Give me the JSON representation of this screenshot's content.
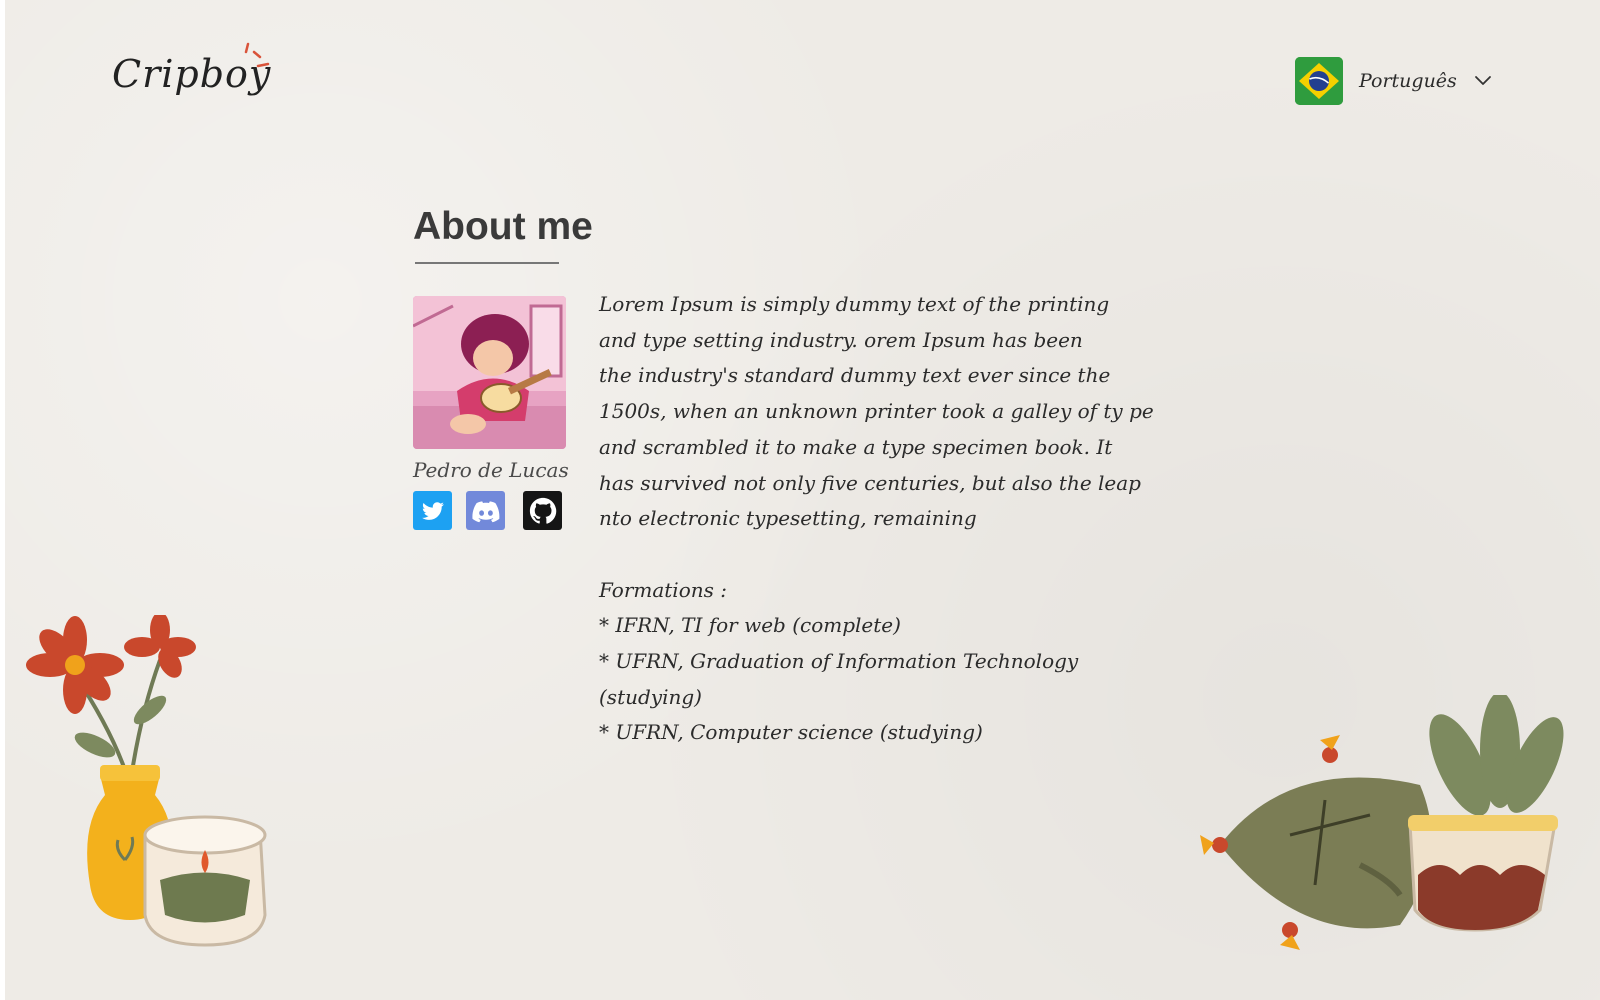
{
  "header": {
    "logo": "Cripboy",
    "language": {
      "label": "Português",
      "flag_icon": "brazil-flag-icon"
    }
  },
  "about": {
    "title": "About me",
    "profile": {
      "name": "Pedro de Lucas",
      "social": [
        {
          "name": "twitter",
          "icon": "twitter-icon",
          "color": "#1da1f2"
        },
        {
          "name": "discord",
          "icon": "discord-icon",
          "color": "#7289da"
        },
        {
          "name": "github",
          "icon": "github-icon",
          "color": "#151515"
        }
      ]
    },
    "bio_lines": [
      "Lorem Ipsum is simply dummy text of the printing",
      "and type setting industry. orem Ipsum has been",
      "the industry's standard dummy text ever since the",
      "1500s, when an unknown printer took a galley of ty pe",
      "and scrambled it to make a type specimen book. It",
      "has survived not only five centuries, but also the leap",
      "nto electronic typesetting, remaining"
    ],
    "formations_label": "Formations :",
    "formations": [
      "* IFRN, TI for web (complete)",
      "* UFRN, Graduation of Information Technology (studying)",
      "* UFRN, Computer science (studying)"
    ]
  },
  "colors": {
    "background": "#eeebe6",
    "twitter": "#1da1f2",
    "discord": "#7289da",
    "github": "#151515"
  }
}
